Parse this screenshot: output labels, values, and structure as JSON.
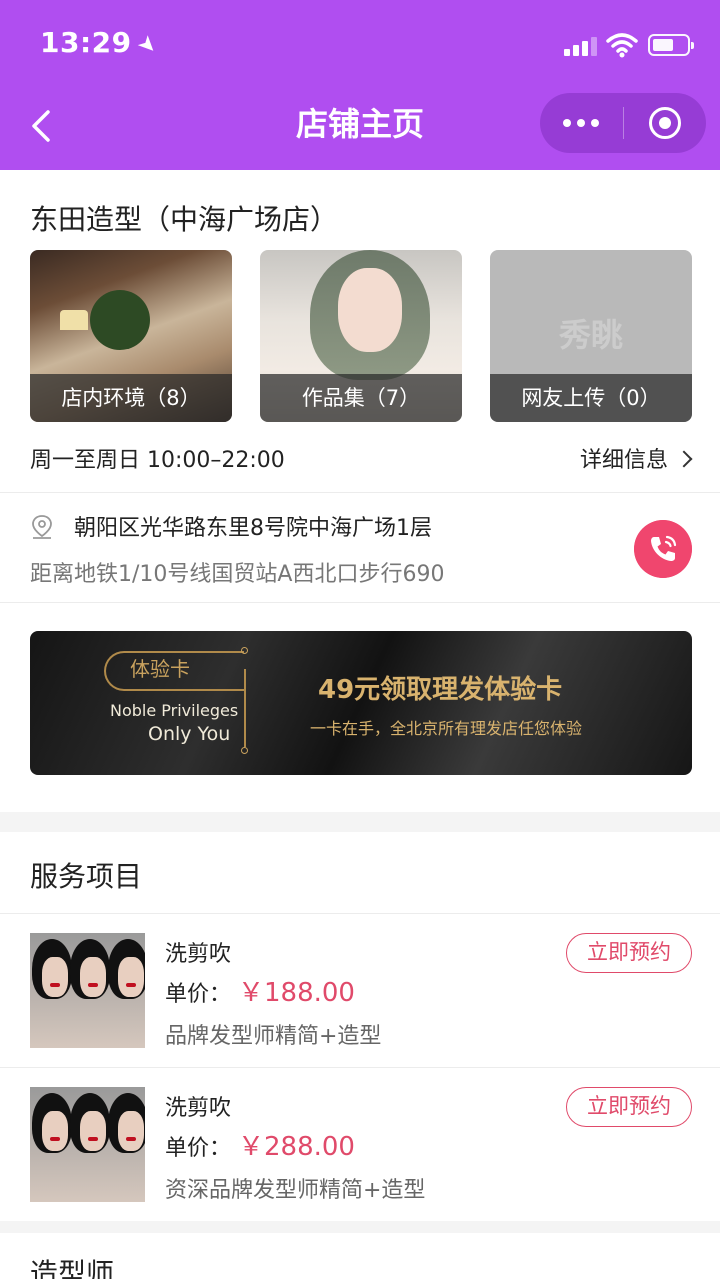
{
  "status_bar": {
    "time": "13:29"
  },
  "nav": {
    "title": "店铺主页"
  },
  "shop": {
    "name": "东田造型（中海广场店）",
    "albums": [
      {
        "label": "店内环境（8）"
      },
      {
        "label": "作品集（7）"
      },
      {
        "label": "网友上传（0）",
        "watermark": "秀眺"
      }
    ],
    "hours": "周一至周日 10:00–22:00",
    "detail_link": "详细信息",
    "address": "朝阳区光华路东里8号院中海广场1层",
    "subway": "距离地铁1/10号线国贸站A西北口步行690"
  },
  "banner": {
    "badge": "体验卡",
    "noble": "Noble Privileges",
    "only_you": "Only You",
    "headline": "49元领取理发体验卡",
    "sub": "一卡在手，全北京所有理发店任您体验"
  },
  "services": {
    "title": "服务项目",
    "items": [
      {
        "name": "洗剪吹",
        "price_label": "单价：",
        "price": "￥188.00",
        "desc": "品牌发型师精简+造型",
        "book": "立即预约"
      },
      {
        "name": "洗剪吹",
        "price_label": "单价：",
        "price": "￥288.00",
        "desc": "资深品牌发型师精简+造型",
        "book": "立即预约"
      }
    ]
  },
  "stylists": {
    "title": "造型师"
  },
  "colors": {
    "header": "#b04ef0",
    "accent": "#e04a6a",
    "call": "#f0466e",
    "gold": "#d9b36e"
  }
}
